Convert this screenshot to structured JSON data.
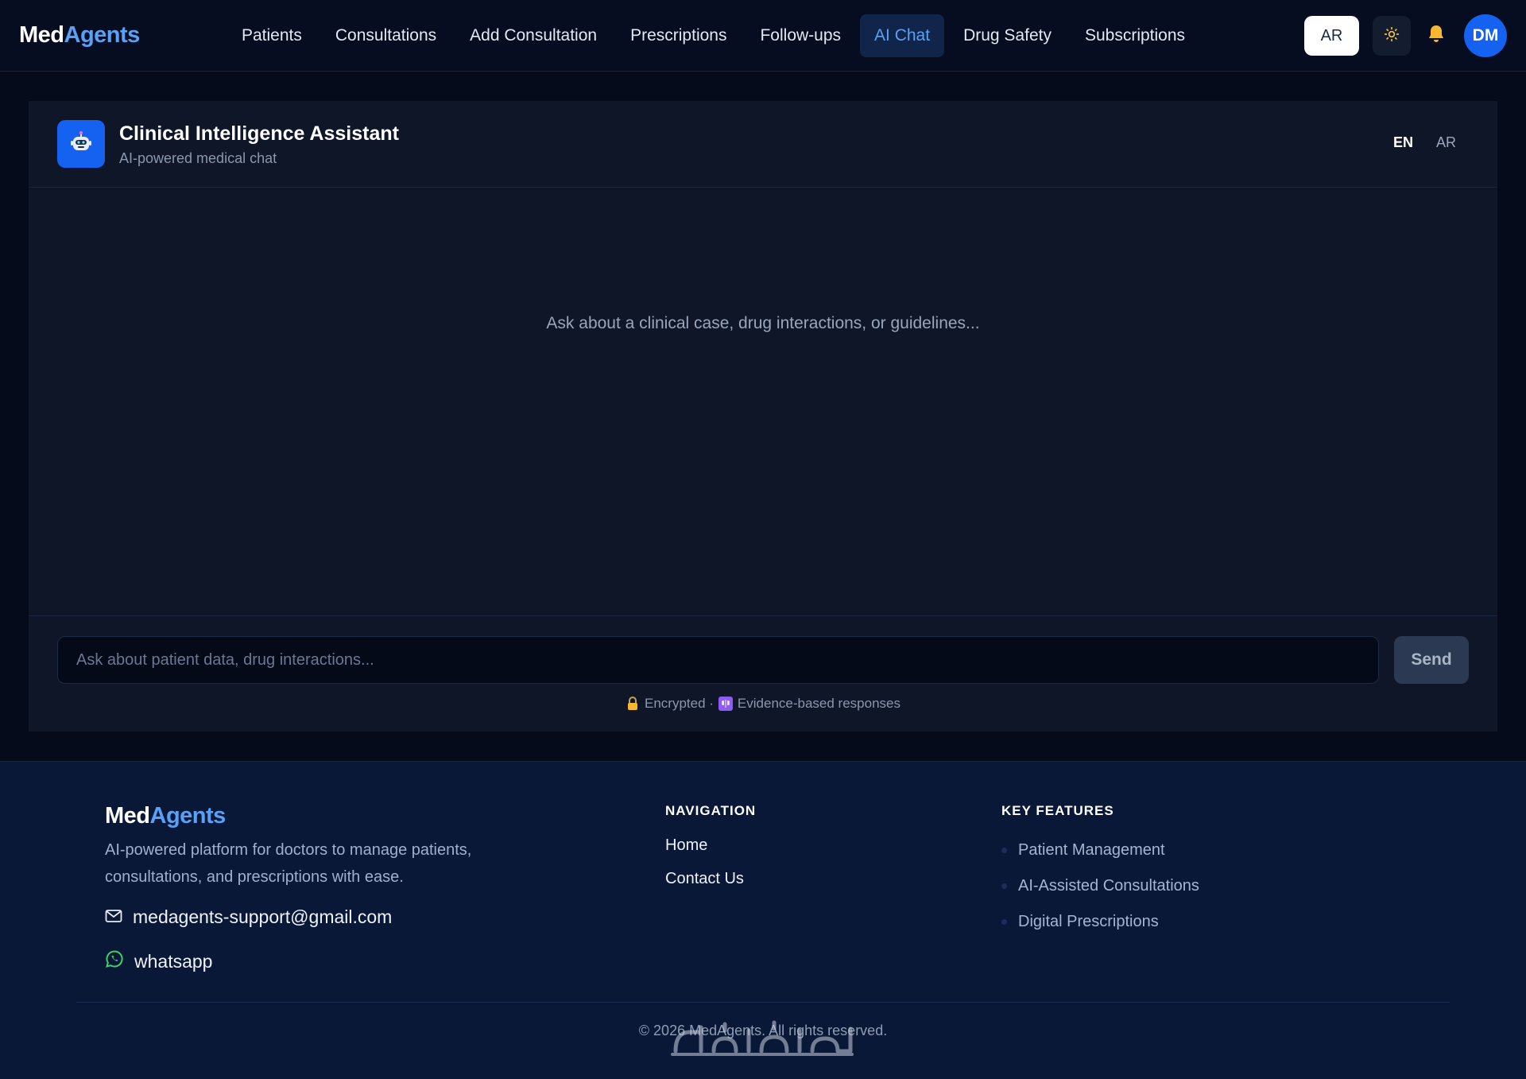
{
  "brand": {
    "part1": "Med",
    "part2": "Agents"
  },
  "nav": {
    "items": [
      {
        "label": "Patients"
      },
      {
        "label": "Consultations"
      },
      {
        "label": "Add Consultation"
      },
      {
        "label": "Prescriptions"
      },
      {
        "label": "Follow-ups"
      },
      {
        "label": "AI Chat",
        "active": true
      },
      {
        "label": "Drug Safety"
      },
      {
        "label": "Subscriptions"
      }
    ],
    "language_button": "AR",
    "theme_icon": "sun-icon",
    "notification_icon": "bell-icon",
    "avatar_initials": "DM"
  },
  "chat": {
    "title": "Clinical Intelligence Assistant",
    "subtitle": "AI-powered medical chat",
    "bot_icon": "robot-icon",
    "lang_options": [
      "EN",
      "AR"
    ],
    "selected_lang": "EN",
    "empty_state": "Ask about a clinical case, drug interactions, or guidelines...",
    "input_placeholder": "Ask about patient data, drug interactions...",
    "input_value": "",
    "send_label": "Send",
    "note": {
      "encrypted": "Encrypted ·",
      "evidence": "Evidence-based responses",
      "lock_icon": "lock-icon",
      "brain_icon": "brain-icon"
    }
  },
  "footer": {
    "brand": {
      "part1": "Med",
      "part2": "Agents"
    },
    "description": "AI-powered platform for doctors to manage patients, consultations, and prescriptions with ease.",
    "email": "medagents-support@gmail.com",
    "whatsapp": "whatsapp",
    "navigation_heading": "NAVIGATION",
    "navigation_links": [
      "Home",
      "Contact Us"
    ],
    "features_heading": "KEY FEATURES",
    "features": [
      "Patient Management",
      "AI-Assisted Consultations",
      "Digital Prescriptions"
    ],
    "copyright": "© 2026 MedAgents. All rights reserved."
  },
  "colors": {
    "accent": "#5aa1f5",
    "primary_blue": "#1662f0",
    "page_bg": "#050b1a",
    "panel_bg": "#0e1628",
    "footer_bg": "#0a1838",
    "theme_icon": "#f5c542",
    "bell_icon": "#f7b731",
    "whatsapp_green": "#3ecf64"
  }
}
